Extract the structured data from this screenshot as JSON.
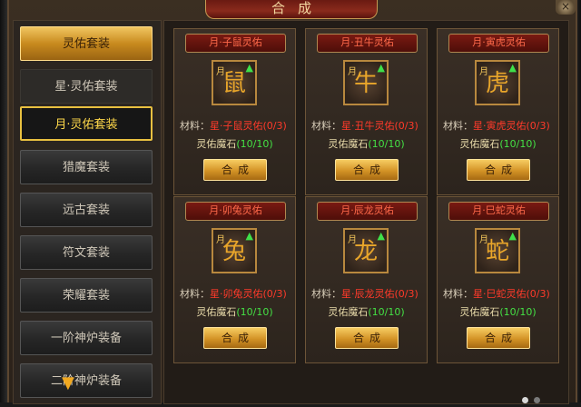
{
  "window": {
    "title": "合成",
    "close_glyph": "×"
  },
  "sidebar": {
    "items": [
      {
        "label": "灵佑套装",
        "state": "gold"
      },
      {
        "label": "星·灵佑套装",
        "state": "plain"
      },
      {
        "label": "月·灵佑套装",
        "state": "selected"
      },
      {
        "label": "猎魔套装",
        "state": "normal"
      },
      {
        "label": "远古套装",
        "state": "normal"
      },
      {
        "label": "符文套装",
        "state": "normal"
      },
      {
        "label": "荣耀套装",
        "state": "normal"
      },
      {
        "label": "一阶神炉装备",
        "state": "normal"
      },
      {
        "label": "二阶神炉装备",
        "state": "normal"
      }
    ],
    "scroll_icon": "chevron-down-icon"
  },
  "cards": [
    {
      "title": "月·子鼠灵佑",
      "icon": "rat-icon",
      "icon_glyph": "鼠",
      "material_label": "材料：",
      "material_item": "星·子鼠灵佑(0/3)",
      "stone": "灵佑魔石",
      "stone_count": "(10/10)",
      "button": "合成"
    },
    {
      "title": "月·丑牛灵佑",
      "icon": "ox-icon",
      "icon_glyph": "牛",
      "material_label": "材料：",
      "material_item": "星·丑牛灵佑(0/3)",
      "stone": "灵佑魔石",
      "stone_count": "(10/10)",
      "button": "合成"
    },
    {
      "title": "月·寅虎灵佑",
      "icon": "tiger-icon",
      "icon_glyph": "虎",
      "material_label": "材料：",
      "material_item": "星·寅虎灵佑(0/3)",
      "stone": "灵佑魔石",
      "stone_count": "(10/10)",
      "button": "合成"
    },
    {
      "title": "月·卯兔灵佑",
      "icon": "rabbit-icon",
      "icon_glyph": "兔",
      "material_label": "材料：",
      "material_item": "星·卯兔灵佑(0/3)",
      "stone": "灵佑魔石",
      "stone_count": "(10/10)",
      "button": "合成"
    },
    {
      "title": "月·辰龙灵佑",
      "icon": "dragon-icon",
      "icon_glyph": "龙",
      "material_label": "材料：",
      "material_item": "星·辰龙灵佑(0/3)",
      "stone": "灵佑魔石",
      "stone_count": "(10/10)",
      "button": "合成"
    },
    {
      "title": "月·巳蛇灵佑",
      "icon": "snake-icon",
      "icon_glyph": "蛇",
      "material_label": "材料：",
      "material_item": "星·巳蛇灵佑(0/3)",
      "stone": "灵佑魔石",
      "stone_count": "(10/10)",
      "button": "合成"
    }
  ],
  "icon_month_glyph": "月",
  "upgrade_arrow_glyph": "▲",
  "pagination": {
    "pages": 2,
    "current": 1
  },
  "colors": {
    "accent_gold": "#f0c560",
    "title_red": "#ff6a4a",
    "material_red": "#ff3a2a",
    "count_green": "#44e044",
    "selected_border": "#e8c040"
  }
}
